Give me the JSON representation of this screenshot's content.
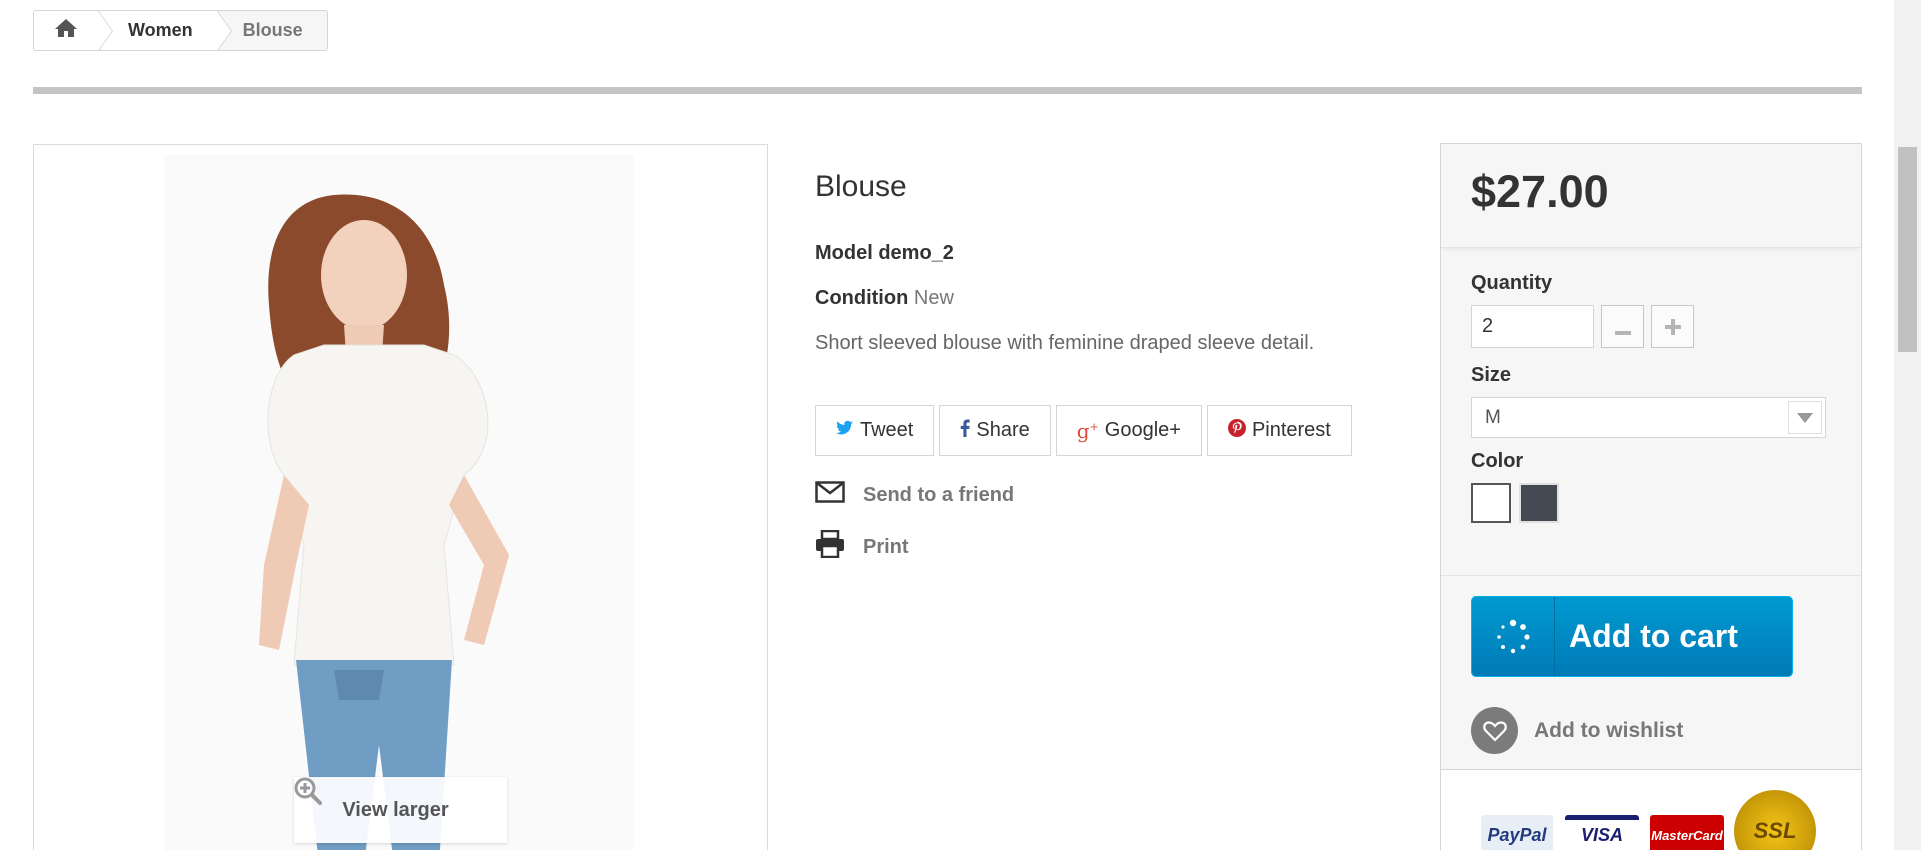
{
  "breadcrumb": {
    "home_icon": "home-icon",
    "items": [
      "Women",
      "Blouse"
    ]
  },
  "product": {
    "image_alt": "Blouse model photo",
    "view_larger": "View larger",
    "title": "Blouse",
    "model_label": "Model",
    "model_value": "demo_2",
    "condition_label": "Condition",
    "condition_value": "New",
    "description": "Short sleeved blouse with feminine draped sleeve detail."
  },
  "social": {
    "tweet": "Tweet",
    "share": "Share",
    "google": "Google+",
    "pinterest": "Pinterest",
    "colors": {
      "twitter": "#1da1f2",
      "facebook": "#3b5998",
      "google": "#dd4b39",
      "pinterest": "#c8232c"
    }
  },
  "links": {
    "send_friend": "Send to a friend",
    "print": "Print"
  },
  "buybox": {
    "price": "$27.00",
    "quantity_label": "Quantity",
    "quantity_value": "2",
    "size_label": "Size",
    "size_value": "M",
    "color_label": "Color",
    "colors": [
      "#ffffff",
      "#434a54"
    ],
    "add_to_cart": "Add to cart",
    "add_to_wishlist": "Add to wishlist",
    "accent": "#0088c7"
  },
  "payments": [
    "PayPal",
    "VISA",
    "MasterCard",
    "SSL"
  ]
}
